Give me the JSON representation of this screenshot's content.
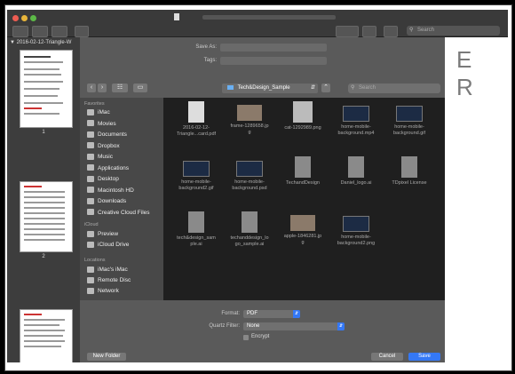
{
  "document": {
    "name": "2016-02-12-Triangle-W",
    "page_numbers": [
      "1",
      "2"
    ],
    "right_page_text": "E R"
  },
  "toolbar": {
    "search_placeholder": "Search"
  },
  "save_dialog": {
    "save_as_label": "Save As:",
    "tags_label": "Tags:",
    "location": "Tech&Design_Sample",
    "search_placeholder": "Search",
    "sidebar": {
      "favorites_header": "Favorites",
      "favorites": [
        "iMac",
        "Movies",
        "Documents",
        "Dropbox",
        "Music",
        "Applications",
        "Desktop",
        "Macintosh HD",
        "Downloads",
        "Creative Cloud Files"
      ],
      "icloud_header": "iCloud",
      "icloud": [
        "Preview",
        "iCloud Drive"
      ],
      "locations_header": "Locations",
      "locations": [
        "iMac's iMac",
        "Remote Disc",
        "Network"
      ]
    },
    "files": [
      {
        "name": "2016-02-12-\nTriangle...card.pdf",
        "kind": "pdf"
      },
      {
        "name": "frame-1289658.jp\ng",
        "kind": "photo"
      },
      {
        "name": "cat-1292989.png",
        "kind": "sketch"
      },
      {
        "name": "home-mobile-\nbackground.mp4",
        "kind": "video"
      },
      {
        "name": "home-mobile-\nbackground.gif",
        "kind": "video"
      },
      {
        "name": "home-mobile-\nbackground2.gif",
        "kind": "video"
      },
      {
        "name": "home-mobile-\nbackground.psd",
        "kind": "video"
      },
      {
        "name": "TechandDesign",
        "kind": "doc"
      },
      {
        "name": "Daniel_logo.ai",
        "kind": "doc"
      },
      {
        "name": "TDpixel License",
        "kind": "doc"
      },
      {
        "name": "tech&design_sam\nple.ai",
        "kind": "doc"
      },
      {
        "name": "techanddesign_lo\ngo_sample.ai",
        "kind": "logo"
      },
      {
        "name": "apple-1846281.jp\ng",
        "kind": "photo"
      },
      {
        "name": "home-mobile-\nbackground2.png",
        "kind": "video"
      }
    ],
    "format_label": "Format:",
    "format_value": "PDF",
    "quartz_label": "Quartz Filter:",
    "quartz_value": "None",
    "encrypt_label": "Encrypt",
    "new_folder_label": "New Folder",
    "cancel_label": "Cancel",
    "save_label": "Save",
    "colors": {
      "accent": "#3478f6"
    }
  }
}
